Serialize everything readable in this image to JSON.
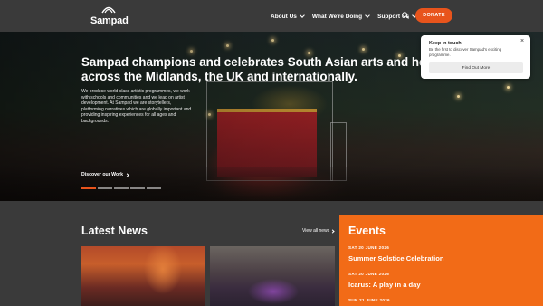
{
  "header": {
    "logo_text": "Sampad",
    "nav": [
      {
        "label": "About Us"
      },
      {
        "label": "What We're Doing"
      },
      {
        "label": "Support Us"
      }
    ],
    "search_icon": "search-icon",
    "donate_label": "DONATE",
    "accent_color": "#e8541c"
  },
  "hero": {
    "title_line1": "Sampad champions and celebrates South Asian arts and heritag",
    "title_line2": "across the Midlands, the UK and internationally.",
    "body": "We produce world-class artistic programmes, we work with schools and communities and we lead on artist development. At Sampad we are storytellers, platforming narratives which are globally important and providing inspiring experiences for all ages and backgrounds.",
    "link_label": "Discover our Work",
    "slides": 5,
    "active_slide": 1
  },
  "popup": {
    "title": "Keep in touch!",
    "text": "Be the first to discover Sampad's exciting programme.",
    "close": "×",
    "button_label": "Find Out More"
  },
  "news": {
    "title": "Latest News",
    "view_all_label": "View all news"
  },
  "events": {
    "title": "Events",
    "background": "#f26b17",
    "items": [
      {
        "date": "SAT 20 JUNE 2026",
        "name": "Summer Solstice Celebration"
      },
      {
        "date": "SAT 20 JUNE 2026",
        "name": "Icarus: A play in a day"
      },
      {
        "date": "SUN 21 JUNE 2026",
        "name": ""
      }
    ]
  }
}
